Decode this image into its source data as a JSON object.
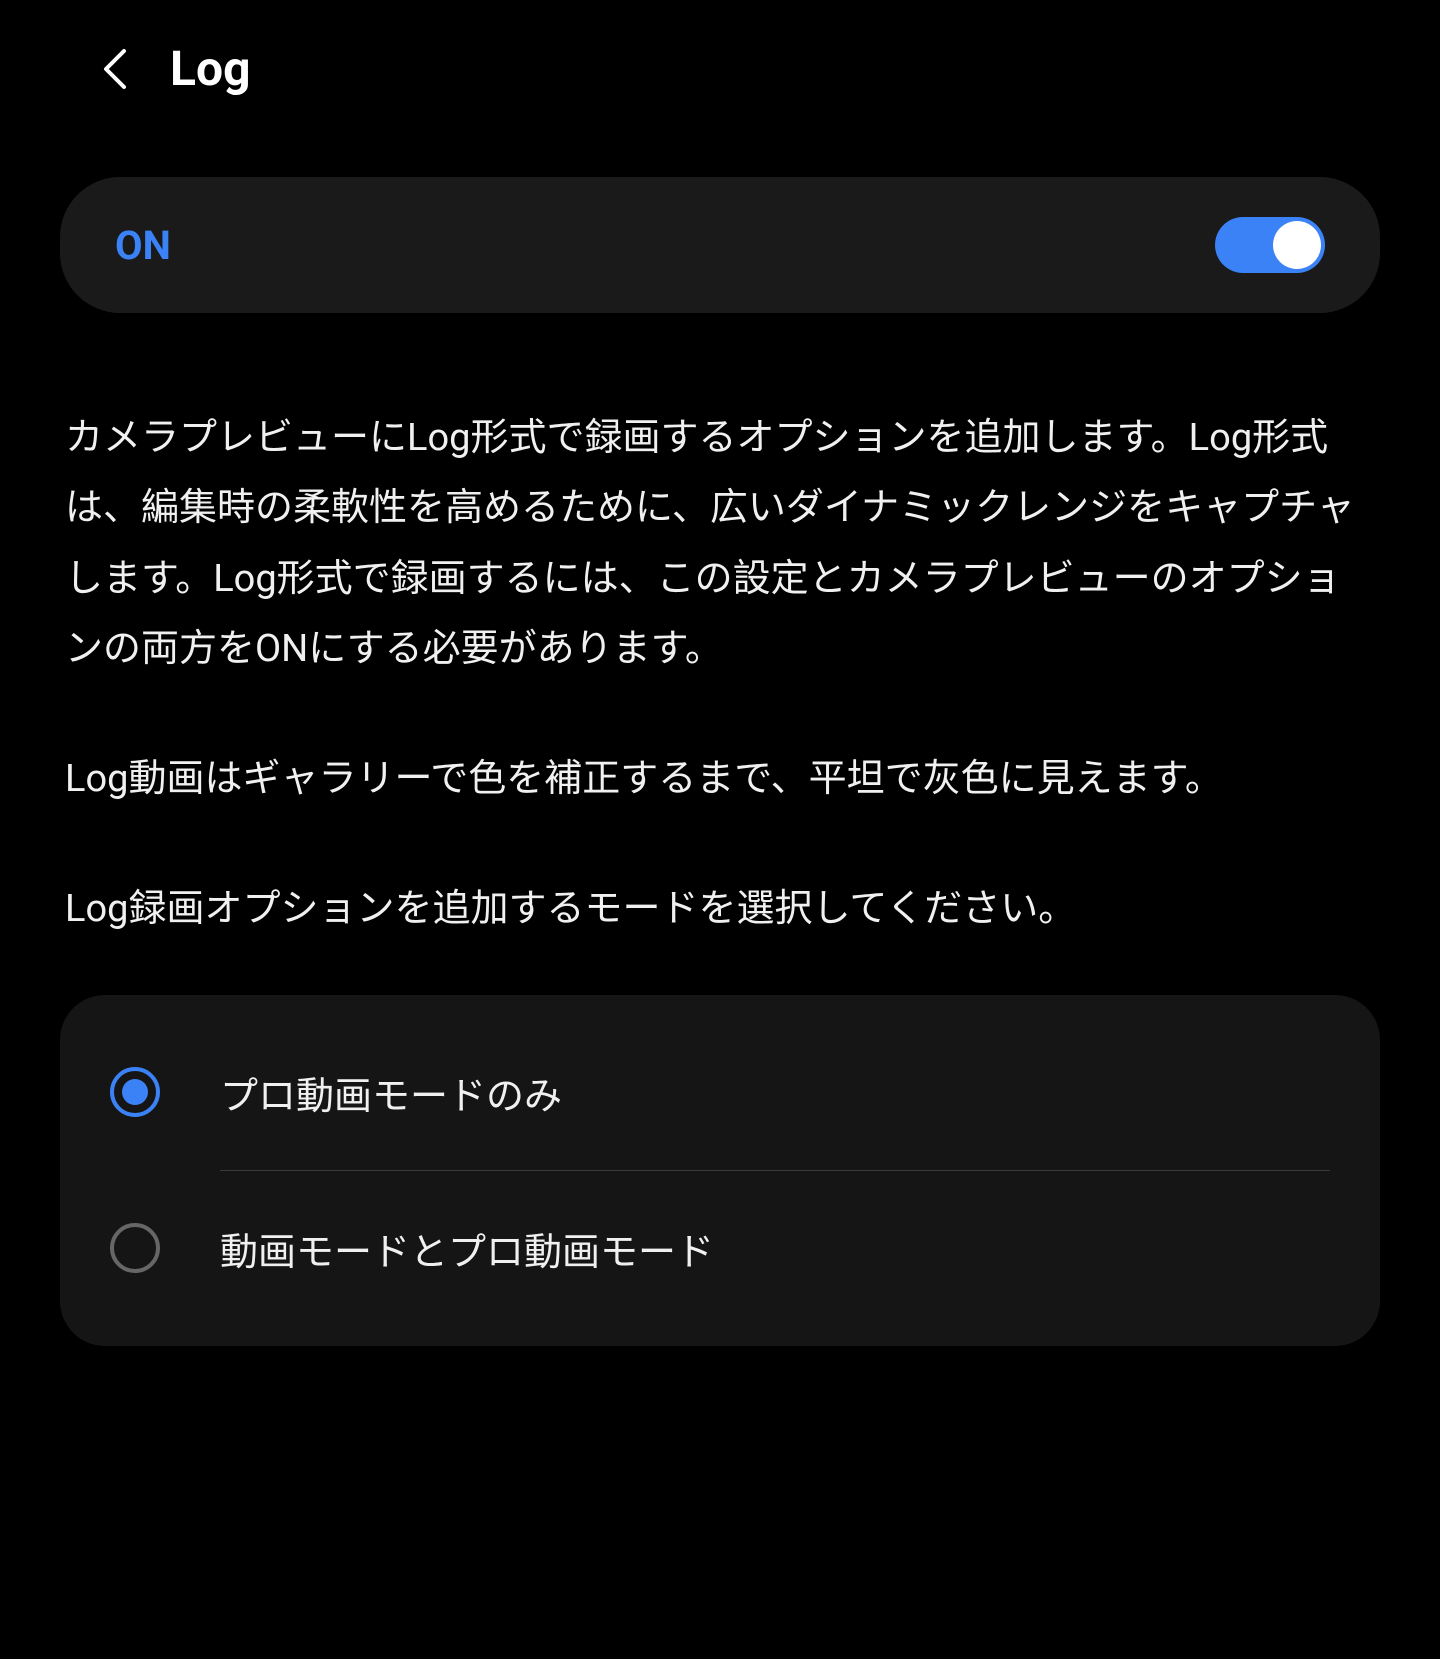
{
  "header": {
    "title": "Log"
  },
  "toggle": {
    "label": "ON",
    "state": true
  },
  "descriptions": {
    "para1": "カメラプレビューにLog形式で録画するオプションを追加します。Log形式は、編集時の柔軟性を高めるために、広いダイナミックレンジをキャプチャします。Log形式で録画するには、この設定とカメラプレビューのオプションの両方をONにする必要があります。",
    "para2": "Log動画はギャラリーで色を補正するまで、平坦で灰色に見えます。",
    "para3": "Log録画オプションを追加するモードを選択してください。"
  },
  "options": [
    {
      "label": "プロ動画モードのみ",
      "selected": true
    },
    {
      "label": "動画モードとプロ動画モード",
      "selected": false
    }
  ]
}
